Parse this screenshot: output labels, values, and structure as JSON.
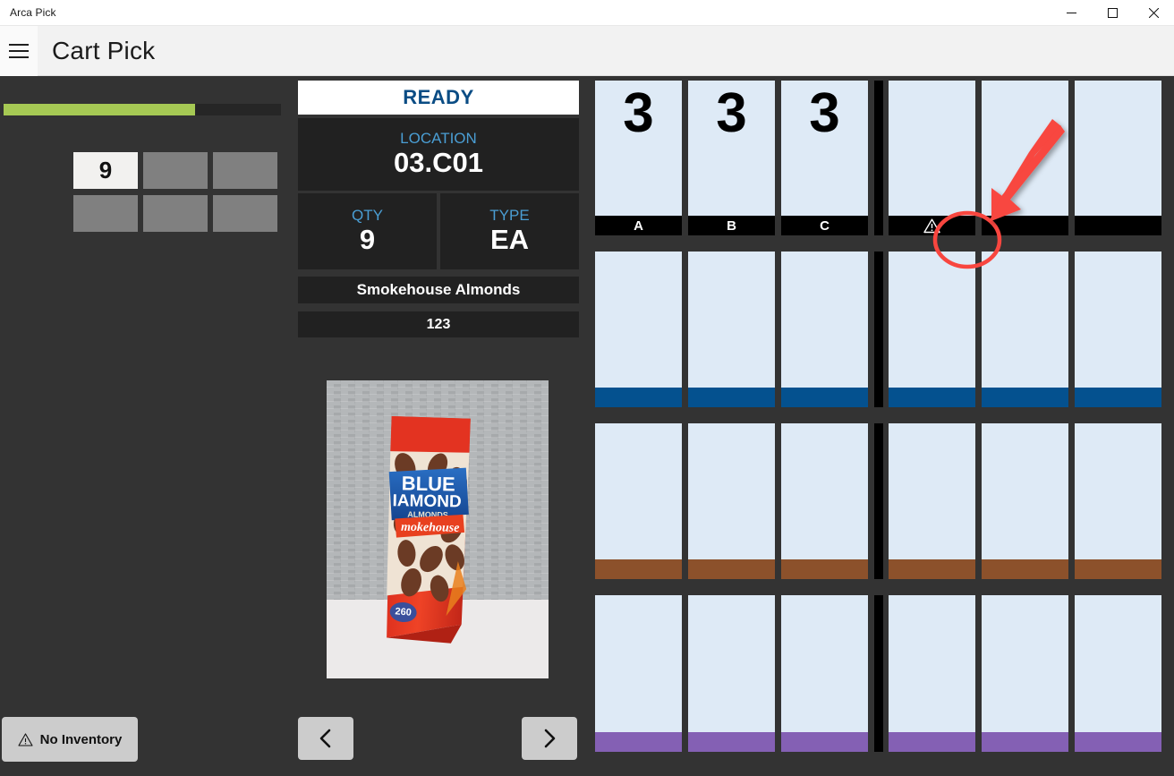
{
  "window": {
    "app_title": "Arca Pick",
    "controls": {
      "minimize": "minimize-icon",
      "maximize": "maximize-icon",
      "close": "close-icon"
    }
  },
  "header": {
    "menu_icon": "hamburger-icon",
    "page_title": "Cart Pick"
  },
  "left_panel": {
    "progress": {
      "percent": 69,
      "fill_color": "#a6c954",
      "track_color": "#262626"
    },
    "totes": [
      {
        "label": "9",
        "active": true
      },
      {
        "label": "",
        "active": false
      },
      {
        "label": "",
        "active": false
      },
      {
        "label": "",
        "active": false
      },
      {
        "label": "",
        "active": false
      },
      {
        "label": "",
        "active": false
      }
    ],
    "no_inventory_button": {
      "label": "No Inventory",
      "icon": "warning-triangle-icon"
    }
  },
  "center_panel": {
    "status": "READY",
    "status_color": "#0a4c84",
    "location_label": "LOCATION",
    "location_value": "03.C01",
    "qty_label": "QTY",
    "qty_value": "9",
    "type_label": "TYPE",
    "type_value": "EA",
    "description": "Smokehouse Almonds",
    "sku": "123",
    "product_image_alt": "Blue Diamond Smokehouse Almonds package",
    "prev_button": "chevron-left-icon",
    "next_button": "chevron-right-icon"
  },
  "cart_grid": {
    "cell_color": "#deeaf6",
    "rows": [
      {
        "bar_color": "#000000",
        "left_cells": [
          {
            "qty": "3",
            "bar_label": "A",
            "bar_icon": ""
          },
          {
            "qty": "3",
            "bar_label": "B",
            "bar_icon": ""
          },
          {
            "qty": "3",
            "bar_label": "C",
            "bar_icon": ""
          }
        ],
        "right_cells": [
          {
            "qty": "",
            "bar_label": "",
            "bar_icon": "warning-triangle-icon"
          },
          {
            "qty": "",
            "bar_label": "",
            "bar_icon": ""
          },
          {
            "qty": "",
            "bar_label": "",
            "bar_icon": ""
          }
        ]
      },
      {
        "bar_color": "#04518f",
        "left_cells": [
          {
            "qty": "",
            "bar_label": "",
            "bar_icon": ""
          },
          {
            "qty": "",
            "bar_label": "",
            "bar_icon": ""
          },
          {
            "qty": "",
            "bar_label": "",
            "bar_icon": ""
          }
        ],
        "right_cells": [
          {
            "qty": "",
            "bar_label": "",
            "bar_icon": ""
          },
          {
            "qty": "",
            "bar_label": "",
            "bar_icon": ""
          },
          {
            "qty": "",
            "bar_label": "",
            "bar_icon": ""
          }
        ]
      },
      {
        "bar_color": "#8c512b",
        "left_cells": [
          {
            "qty": "",
            "bar_label": "",
            "bar_icon": ""
          },
          {
            "qty": "",
            "bar_label": "",
            "bar_icon": ""
          },
          {
            "qty": "",
            "bar_label": "",
            "bar_icon": ""
          }
        ],
        "right_cells": [
          {
            "qty": "",
            "bar_label": "",
            "bar_icon": ""
          },
          {
            "qty": "",
            "bar_label": "",
            "bar_icon": ""
          },
          {
            "qty": "",
            "bar_label": "",
            "bar_icon": ""
          }
        ]
      },
      {
        "bar_color": "#8460b4",
        "left_cells": [
          {
            "qty": "",
            "bar_label": "",
            "bar_icon": ""
          },
          {
            "qty": "",
            "bar_label": "",
            "bar_icon": ""
          },
          {
            "qty": "",
            "bar_label": "",
            "bar_icon": ""
          }
        ],
        "right_cells": [
          {
            "qty": "",
            "bar_label": "",
            "bar_icon": ""
          },
          {
            "qty": "",
            "bar_label": "",
            "bar_icon": ""
          },
          {
            "qty": "",
            "bar_label": "",
            "bar_icon": ""
          }
        ]
      }
    ]
  },
  "annotation": {
    "arrow_color": "#f8463f",
    "highlight_shape": "ellipse",
    "target": "warning-triangle-icon"
  }
}
